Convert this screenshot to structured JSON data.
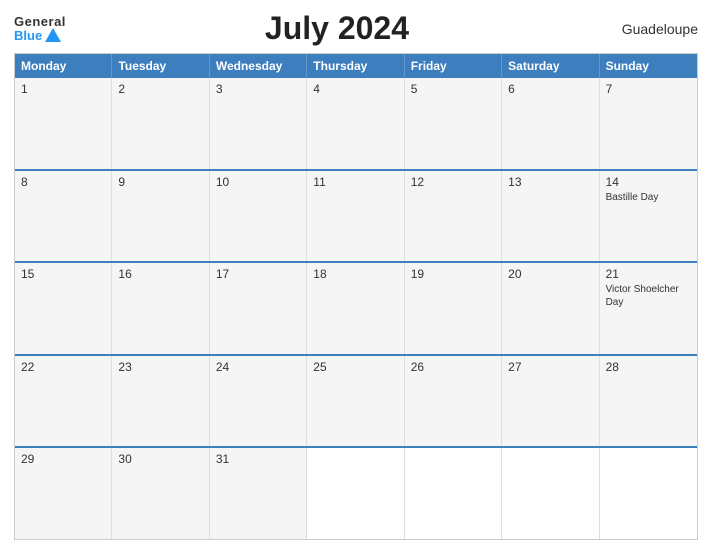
{
  "logo": {
    "general": "General",
    "blue": "Blue"
  },
  "title": "July 2024",
  "country": "Guadeloupe",
  "days_header": [
    "Monday",
    "Tuesday",
    "Wednesday",
    "Thursday",
    "Friday",
    "Saturday",
    "Sunday"
  ],
  "weeks": [
    [
      {
        "day": 1,
        "event": ""
      },
      {
        "day": 2,
        "event": ""
      },
      {
        "day": 3,
        "event": ""
      },
      {
        "day": 4,
        "event": ""
      },
      {
        "day": 5,
        "event": ""
      },
      {
        "day": 6,
        "event": ""
      },
      {
        "day": 7,
        "event": ""
      }
    ],
    [
      {
        "day": 8,
        "event": ""
      },
      {
        "day": 9,
        "event": ""
      },
      {
        "day": 10,
        "event": ""
      },
      {
        "day": 11,
        "event": ""
      },
      {
        "day": 12,
        "event": ""
      },
      {
        "day": 13,
        "event": ""
      },
      {
        "day": 14,
        "event": "Bastille Day"
      }
    ],
    [
      {
        "day": 15,
        "event": ""
      },
      {
        "day": 16,
        "event": ""
      },
      {
        "day": 17,
        "event": ""
      },
      {
        "day": 18,
        "event": ""
      },
      {
        "day": 19,
        "event": ""
      },
      {
        "day": 20,
        "event": ""
      },
      {
        "day": 21,
        "event": "Victor Shoelcher Day"
      }
    ],
    [
      {
        "day": 22,
        "event": ""
      },
      {
        "day": 23,
        "event": ""
      },
      {
        "day": 24,
        "event": ""
      },
      {
        "day": 25,
        "event": ""
      },
      {
        "day": 26,
        "event": ""
      },
      {
        "day": 27,
        "event": ""
      },
      {
        "day": 28,
        "event": ""
      }
    ],
    [
      {
        "day": 29,
        "event": ""
      },
      {
        "day": 30,
        "event": ""
      },
      {
        "day": 31,
        "event": ""
      },
      {
        "day": null,
        "event": ""
      },
      {
        "day": null,
        "event": ""
      },
      {
        "day": null,
        "event": ""
      },
      {
        "day": null,
        "event": ""
      }
    ]
  ]
}
